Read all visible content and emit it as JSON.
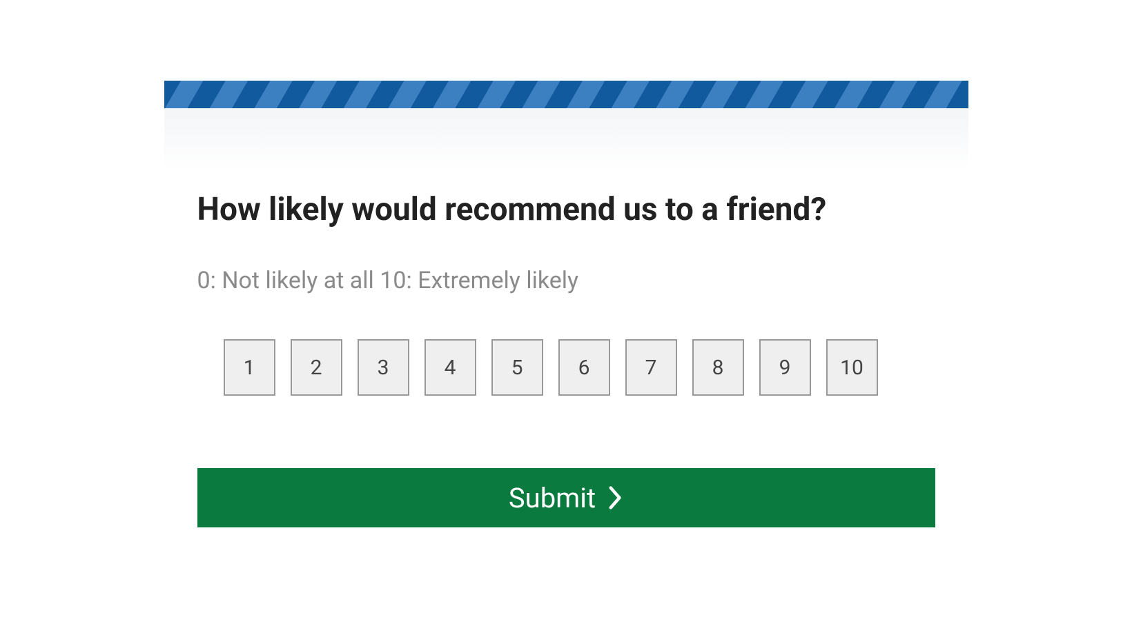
{
  "question": {
    "title": "How likely would recommend us to a friend?",
    "legend": "0: Not likely at all 10: Extremely likely",
    "options": [
      "1",
      "2",
      "3",
      "4",
      "5",
      "6",
      "7",
      "8",
      "9",
      "10"
    ]
  },
  "submit": {
    "label": "Submit"
  },
  "colors": {
    "stripe_dark": "#125a9e",
    "stripe_light": "#3c80c2",
    "submit_bg": "#0b7a3e"
  }
}
